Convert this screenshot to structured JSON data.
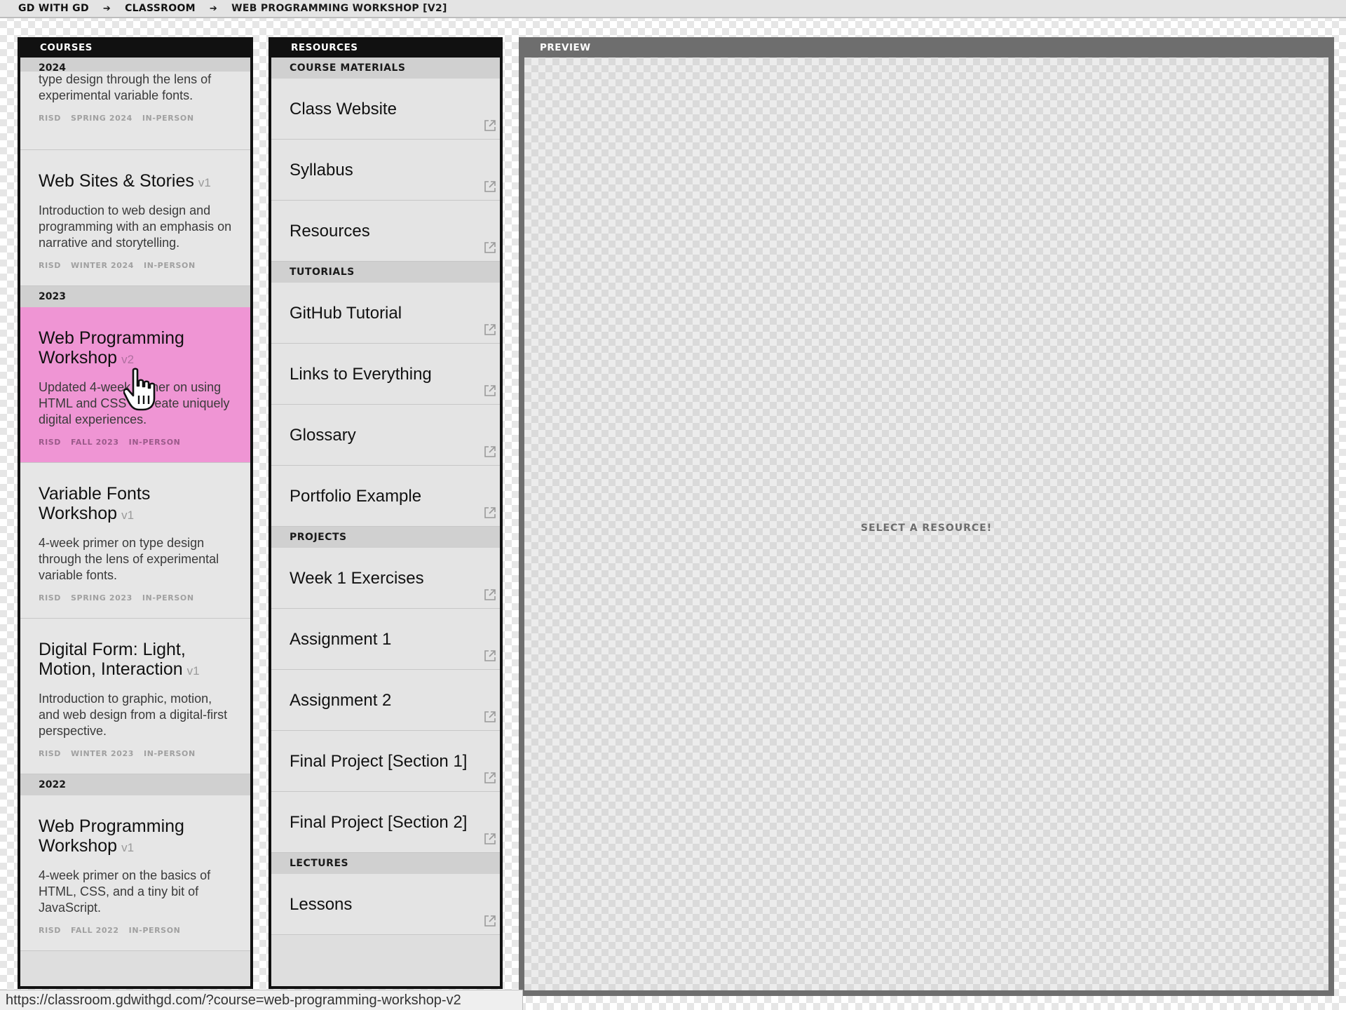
{
  "breadcrumb": {
    "items": [
      "GD WITH GD",
      "CLASSROOM",
      "WEB PROGRAMMING WORKSHOP [V2]"
    ],
    "separator": "➔"
  },
  "courses": {
    "header": "COURSES",
    "groups": [
      {
        "year": "2024",
        "items": [
          {
            "title": "",
            "version": "",
            "desc": "type design through the lens of experimental variable fonts.",
            "meta": [
              "RISD",
              "SPRING 2024",
              "IN-PERSON"
            ]
          },
          {
            "title": "Web Sites & Stories",
            "version": "v1",
            "desc": "Introduction to web design and programming with an emphasis on narrative and storytelling.",
            "meta": [
              "RISD",
              "WINTER 2024",
              "IN-PERSON"
            ]
          }
        ]
      },
      {
        "year": "2023",
        "items": [
          {
            "title": "Web Programming Workshop",
            "version": "v2",
            "desc": "Updated 4-week primer on using HTML and CSS to create uniquely digital experiences.",
            "meta": [
              "RISD",
              "FALL 2023",
              "IN-PERSON"
            ]
          },
          {
            "title": "Variable Fonts Workshop",
            "version": "v1",
            "desc": "4-week primer on type design through the lens of experimental variable fonts.",
            "meta": [
              "RISD",
              "SPRING 2023",
              "IN-PERSON"
            ]
          },
          {
            "title": "Digital Form: Light, Motion, Interaction",
            "version": "v1",
            "desc": "Introduction to graphic, motion, and web design from a digital-first perspective.",
            "meta": [
              "RISD",
              "WINTER 2023",
              "IN-PERSON"
            ]
          }
        ]
      },
      {
        "year": "2022",
        "items": [
          {
            "title": "Web Programming Workshop",
            "version": "v1",
            "desc": "4-week primer on the basics of HTML, CSS, and a tiny bit of JavaScript.",
            "meta": [
              "RISD",
              "FALL 2022",
              "IN-PERSON"
            ]
          }
        ]
      }
    ]
  },
  "resources": {
    "header": "RESOURCES",
    "sections": [
      {
        "label": "COURSE MATERIALS",
        "items": [
          "Class Website",
          "Syllabus",
          "Resources"
        ]
      },
      {
        "label": "TUTORIALS",
        "items": [
          "GitHub Tutorial",
          "Links to Everything",
          "Glossary",
          "Portfolio Example"
        ]
      },
      {
        "label": "PROJECTS",
        "items": [
          "Week 1 Exercises",
          "Assignment 1",
          "Assignment 2",
          "Final Project [Section 1]",
          "Final Project [Section 2]"
        ]
      },
      {
        "label": "LECTURES",
        "items": [
          "Lessons"
        ]
      }
    ]
  },
  "preview": {
    "header": "PREVIEW",
    "empty_message": "SELECT A RESOURCE!"
  },
  "status_url": "https://classroom.gdwithgd.com/?course=web-programming-workshop-v2",
  "colors": {
    "active_course": "#ef95d4",
    "panel_border": "#111111",
    "preview_border": "#6e6e6e"
  },
  "icons": {
    "external_link": "external-link-icon",
    "cursor": "hand-pointer-icon"
  }
}
